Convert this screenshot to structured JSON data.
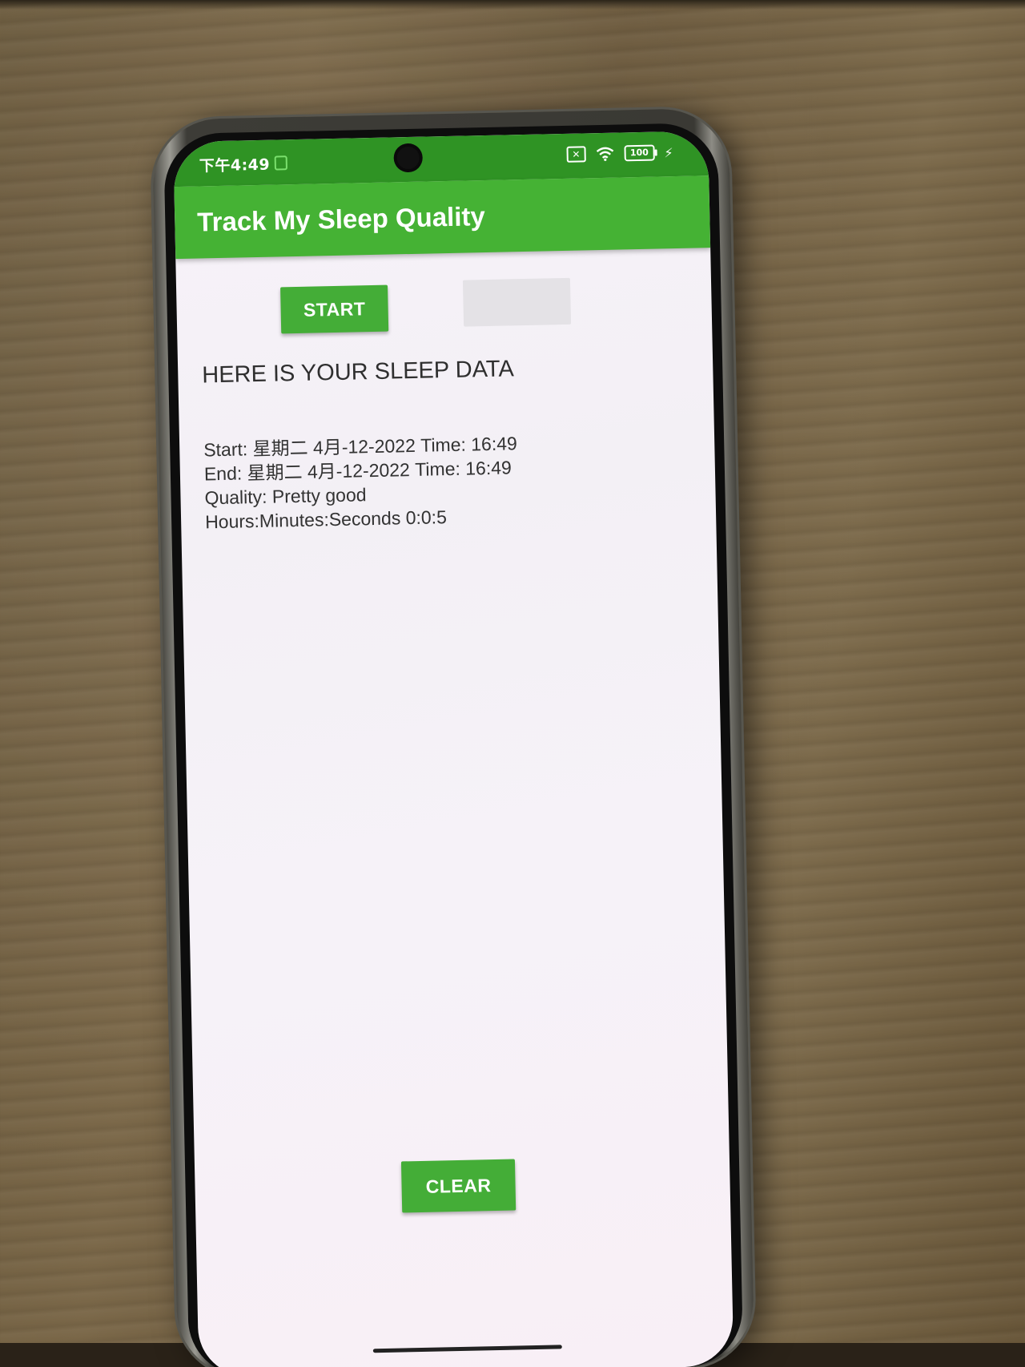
{
  "status_bar": {
    "time": "下午4:49",
    "battery": "100"
  },
  "app_bar": {
    "title": "Track My Sleep Quality"
  },
  "buttons": {
    "start": "START",
    "clear": "CLEAR"
  },
  "content": {
    "heading": "HERE IS YOUR SLEEP DATA",
    "sleep_data": [
      "Start:  星期二 4月-12-2022 Time: 16:49",
      "End:  星期二 4月-12-2022 Time: 16:49",
      "Quality: Pretty good",
      "Hours:Minutes:Seconds 0:0:5"
    ]
  },
  "colors": {
    "status_bar": "#2f9324",
    "app_bar": "#45b234",
    "button": "#44ad37"
  }
}
